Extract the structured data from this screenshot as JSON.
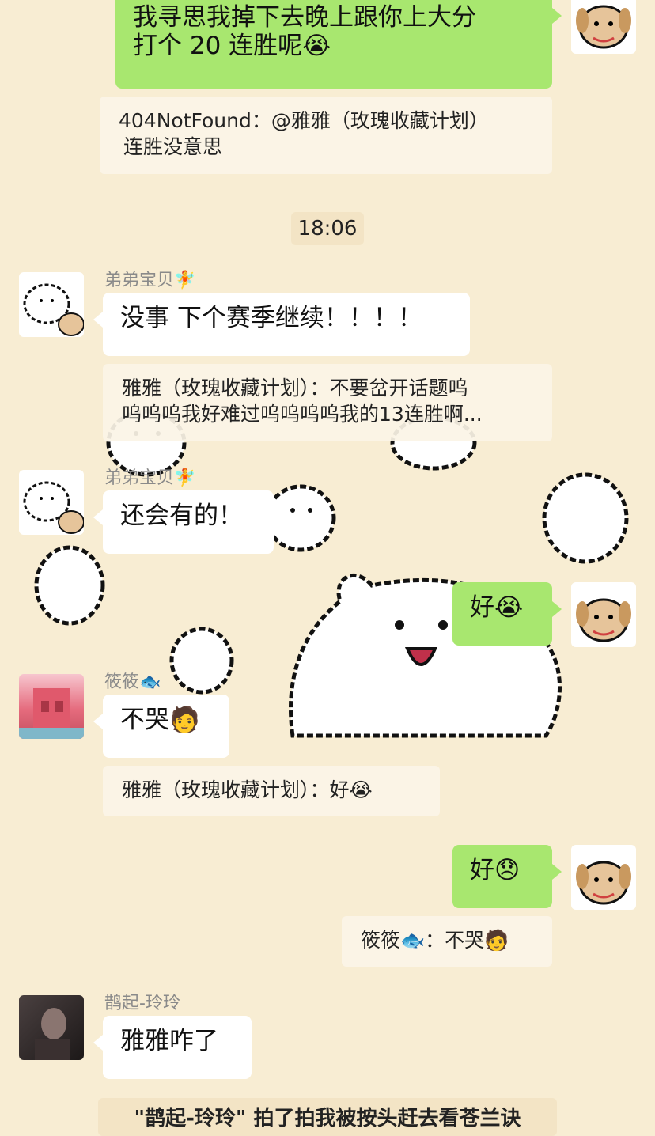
{
  "messages": {
    "m1": {
      "line1": "我寻思我掉下去晚上跟你上大分",
      "line2": "打个 20 连胜呢😭"
    },
    "q1": {
      "line1": "404NotFound：@雅雅（玫瑰收藏计划）",
      "line2": "连胜没意思"
    },
    "time": "18:06",
    "n1": "弟弟宝贝🧚",
    "m2": "没事 下个赛季继续！！！！",
    "q2": {
      "line1": "雅雅（玫瑰收藏计划）：不要岔开话题呜",
      "line2": "呜呜呜我好难过呜呜呜呜我的13连胜啊..."
    },
    "n2": "弟弟宝贝🧚",
    "m3": "还会有的！",
    "m4": "好😭",
    "n3": "筱筱🐟",
    "m5": "不哭🧑",
    "q3": "雅雅（玫瑰收藏计划）：好😭",
    "m6": "好😞",
    "q4": "筱筱🐟：不哭🧑",
    "n4": "鹊起-玲玲",
    "m7": "雅雅咋了",
    "system": "\"鹊起-玲玲\" 拍了拍我被按头赶去看苍兰诀"
  },
  "avatars": {
    "self": "dog-avatar",
    "didi": "white-dog-avatar",
    "xiaoxiao": "pink-building-avatar",
    "lingling": "dark-portrait-avatar"
  }
}
